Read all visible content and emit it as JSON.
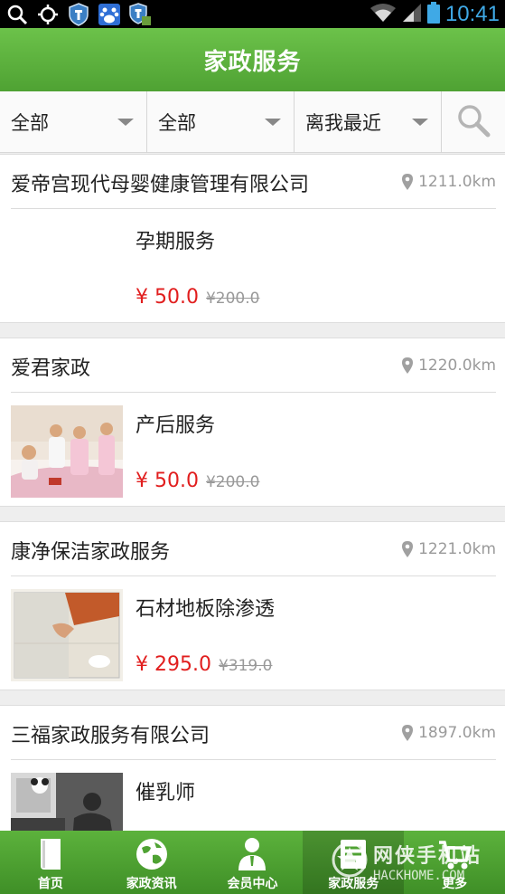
{
  "status_bar": {
    "time": "10:41",
    "left_icons": [
      "search-icon",
      "location-icon",
      "shield-icon",
      "baidu-icon",
      "shield-icon"
    ],
    "right_icons": [
      "wifi-icon",
      "signal-icon",
      "battery-icon"
    ]
  },
  "header": {
    "title": "家政服务"
  },
  "filters": {
    "items": [
      {
        "label": "全部"
      },
      {
        "label": "全部"
      },
      {
        "label": "离我最近"
      }
    ],
    "search_icon": "search-icon"
  },
  "listings": [
    {
      "company": "爱帝宫现代母婴健康管理有限公司",
      "distance": "1211.0km",
      "service": "孕期服务",
      "price": "¥ 50.0",
      "original_price": "¥200.0",
      "thumbnail": "none"
    },
    {
      "company": "爱君家政",
      "distance": "1220.0km",
      "service": "产后服务",
      "price": "¥ 50.0",
      "original_price": "¥200.0",
      "thumbnail": "nurses-photo"
    },
    {
      "company": "康净保洁家政服务",
      "distance": "1221.0km",
      "service": "石材地板除渗透",
      "price": "¥ 295.0",
      "original_price": "¥319.0",
      "thumbnail": "floor-cleaning-photo"
    },
    {
      "company": "三福家政服务有限公司",
      "distance": "1897.0km",
      "service": "催乳师",
      "price": "",
      "original_price": "",
      "thumbnail": "mother-baby-photo"
    }
  ],
  "bottom_nav": {
    "items": [
      {
        "label": "首页",
        "icon": "book-icon",
        "active": false
      },
      {
        "label": "家政资讯",
        "icon": "globe-icon",
        "active": false
      },
      {
        "label": "会员中心",
        "icon": "member-icon",
        "active": false
      },
      {
        "label": "家政服务",
        "icon": "service-icon",
        "active": true
      },
      {
        "label": "更多",
        "icon": "cart-icon",
        "active": false
      }
    ]
  },
  "watermark": {
    "text": "网侠手机站",
    "sub": "HACKHOME.COM"
  },
  "colors": {
    "header_green": "#5cb23c",
    "price_red": "#e11e1e",
    "time_blue": "#3fa9e6"
  }
}
